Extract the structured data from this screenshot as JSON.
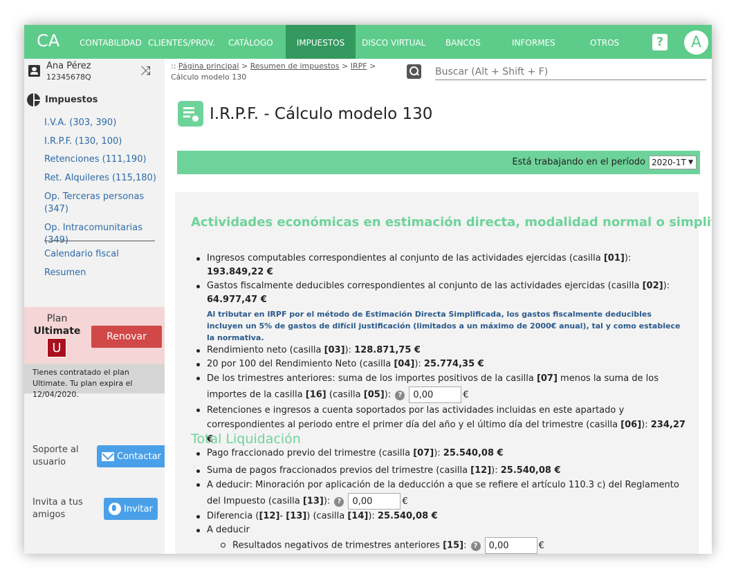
{
  "nav": {
    "logo": "CA",
    "items": [
      "Contabilidad",
      "Clientes/Prov.",
      "Catálogo",
      "Impuestos",
      "Disco virtual",
      "Bancos",
      "Informes",
      "Otros"
    ],
    "help": "?",
    "avatar_letter": "A",
    "accent": "#5dcc8a",
    "active_color": "#34995f"
  },
  "user": {
    "name": "Ana Pérez",
    "nif": "12345678Q"
  },
  "sidebar": {
    "section_title": "Impuestos",
    "links": [
      "I.V.A. (303, 390)",
      "I.R.P.F. (130, 100)",
      "Retenciones (111,190)",
      "Ret. Alquileres (115,180)",
      "Op. Terceras personas (347)",
      "Op. Intracomunitarias (349)"
    ],
    "extra_links": [
      "Calendario fiscal",
      "Resumen"
    ],
    "plan": {
      "label": "Plan",
      "name": "Ultimate",
      "badge": "U",
      "renew_label": "Renovar",
      "info": "Tienes contratado el plan Ultimate. Tu plan expira el 12/04/2020."
    },
    "support": {
      "label": "Soporte al usuario",
      "button": "Contactar"
    },
    "invite": {
      "label": "Invita a tus amigos",
      "button": "Invitar"
    }
  },
  "breadcrumb": {
    "prefix": ":: ",
    "items": [
      "Página principal",
      "Resumen de impuestos",
      "IRPF"
    ],
    "current": "Cálculo modelo 130",
    "separator": " > "
  },
  "search": {
    "placeholder": "Buscar (Alt + Shift + F)"
  },
  "page": {
    "title": "I.R.P.F. - Cálculo modelo 130",
    "period_label": "Está trabajando en el período",
    "period_value": "2020-1T"
  },
  "section1": {
    "title": "Actividades económicas en estimación directa, modalidad normal o simplificada.",
    "ingresos": {
      "text": "Ingresos computables correspondientes al conjunto de las actividades ejercidas (casilla ",
      "box": "[01]",
      "tail": "): ",
      "value": "193.849,22 €"
    },
    "gastos": {
      "text": "Gastos fiscalmente deducibles correspondientes al conjunto de las actividades ejercidas (casilla ",
      "box": "[02]",
      "tail": "): ",
      "value": "64.977,47 €",
      "note": "Al tributar en IRPF por el método de Estimación Directa Simplificada, los gastos fiscalmente deducibles incluyen un 5% de gastos de difícil justificación (limitados a un máximo de 2000€ anual), tal y como establece la normativa."
    },
    "rendimiento": {
      "text": "Rendimiento neto (casilla ",
      "box": "[03]",
      "tail": "): ",
      "value": "128.871,75 €"
    },
    "veinte": {
      "text": "20 por 100 del Rendimiento Neto (casilla ",
      "box": "[04]",
      "tail": "): ",
      "value": "25.774,35 €"
    },
    "anteriores": {
      "text": "De los trimestres anteriores: suma de los importes positivos de la casilla ",
      "box_a": "[07]",
      "mid": " menos la suma de los importes de la casilla ",
      "box_b": "[16]",
      "mid2": " (casilla ",
      "box_c": "[05]",
      "tail": "): ",
      "input_value": "0,00",
      "currency": "€"
    },
    "retenciones": {
      "text": "Retenciones e ingresos a cuenta soportados por las actividades incluidas en este apartado y correspondientes al periodo entre el primer día del año y el último día del trimestre (casilla ",
      "box": "[06]",
      "tail": "): ",
      "value": "234,27 €"
    },
    "pago": {
      "text": "Pago fraccionado previo del trimestre (casilla ",
      "box": "[07]",
      "tail": "): ",
      "value": "25.540,08 €"
    }
  },
  "section2": {
    "title": "Total Liquidación",
    "suma": {
      "text": "Suma de pagos fraccionados previos del trimestre (casilla ",
      "box": "[12]",
      "tail": "): ",
      "value": "25.540,08 €"
    },
    "deducir1": {
      "text": "A deducir: Minoración por aplicación de la deducción a que se refiere el artículo 110.3 c) del Reglamento del Impuesto (casilla ",
      "box": "[13]",
      "tail": "): ",
      "input_value": "0,00",
      "currency": "€"
    },
    "diferencia": {
      "text": "Diferencia (",
      "box_a": "[12]",
      "mid": "- ",
      "box_b": "[13]",
      "mid2": ") (casilla ",
      "box_c": "[14]",
      "tail": "): ",
      "value": "25.540,08 €"
    },
    "deducir2": {
      "text": "A deducir"
    },
    "negativos": {
      "text": "Resultados negativos de trimestres anteriores ",
      "box": "[15]",
      "tail": ": ",
      "input_value": "0,00",
      "currency": "€"
    }
  },
  "colors": {
    "panel": "#f3f3f3",
    "section_title": "#6ed39a",
    "note": "#2a5a8c",
    "renew": "#d04848",
    "blue_btn": "#4aa0e8"
  }
}
